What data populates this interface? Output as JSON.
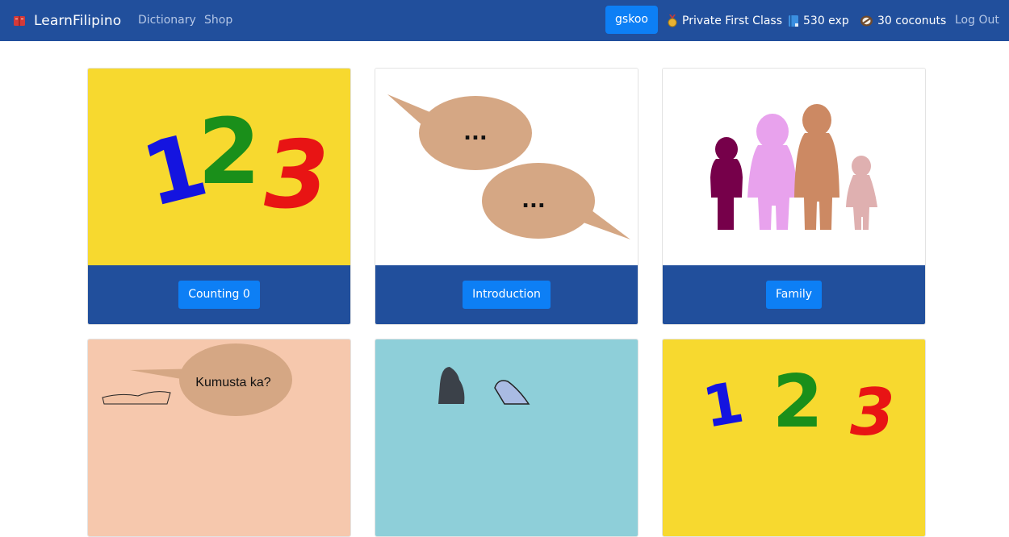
{
  "nav": {
    "brand": "LearnFilipino",
    "links": [
      "Dictionary",
      "Shop"
    ],
    "username": "gskoo",
    "rank": "Private First Class",
    "exp": "530 exp",
    "coconuts": "30 coconuts",
    "logout": "Log Out"
  },
  "lessons": [
    {
      "label": "Counting 0",
      "image": "numbers-123",
      "bg": "#f7d92f"
    },
    {
      "label": "Introduction",
      "image": "speech-bubbles",
      "bg": "#ffffff"
    },
    {
      "label": "Family",
      "image": "family-silhouettes",
      "bg": "#ffffff"
    },
    {
      "image": "kumusta-greeting",
      "bubble_text": "Kumusta ka?",
      "bg": "#f6c8ad"
    },
    {
      "image": "animals",
      "bg": "#8ecfd9"
    },
    {
      "image": "numbers-123",
      "bg": "#f7d92f"
    }
  ],
  "colors": {
    "navbar": "#214f9c",
    "button": "#0d7ff5"
  },
  "image_text": {
    "one": "1",
    "two": "2",
    "three": "3",
    "dots": "..."
  }
}
